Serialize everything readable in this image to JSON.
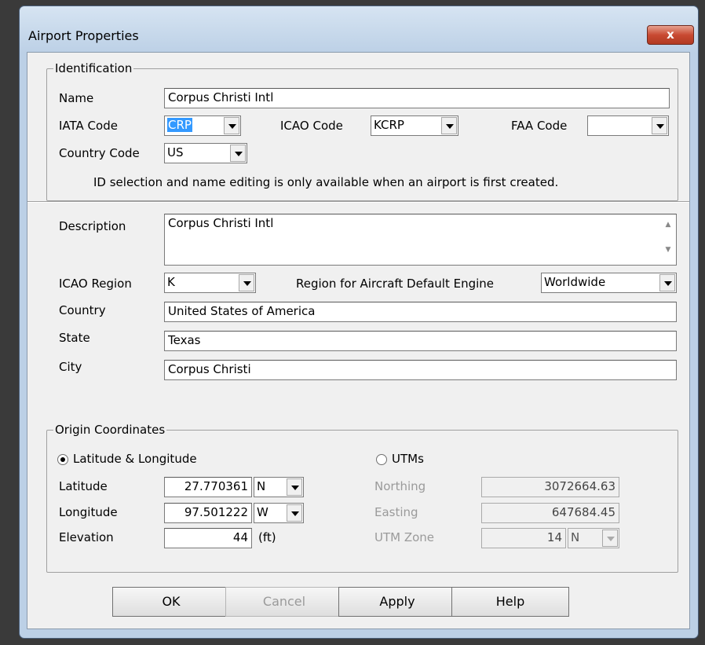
{
  "window": {
    "title": "Airport Properties",
    "close_glyph": "x"
  },
  "identification": {
    "legend": "Identification",
    "name_label": "Name",
    "name_value": "Corpus Christi Intl",
    "iata_label": "IATA Code",
    "iata_value": "CRP",
    "icao_label": "ICAO Code",
    "icao_value": "KCRP",
    "faa_label": "FAA Code",
    "faa_value": "",
    "country_code_label": "Country Code",
    "country_code_value": "US",
    "note": "ID selection and name editing is only available when an airport is first created."
  },
  "details": {
    "description_label": "Description",
    "description_value": "Corpus Christi Intl",
    "icao_region_label": "ICAO Region",
    "icao_region_value": "K",
    "engine_region_label": "Region for Aircraft Default Engine",
    "engine_region_value": "Worldwide",
    "country_label": "Country",
    "country_value": "United States of America",
    "state_label": "State",
    "state_value": "Texas",
    "city_label": "City",
    "city_value": "Corpus Christi"
  },
  "origin": {
    "legend": "Origin Coordinates",
    "latlon_radio_label": "Latitude & Longitude",
    "latlon_selected": true,
    "utm_radio_label": "UTMs",
    "latitude_label": "Latitude",
    "latitude_value": "27.770361",
    "latitude_hemi": "N",
    "longitude_label": "Longitude",
    "longitude_value": "97.501222",
    "longitude_hemi": "W",
    "elevation_label": "Elevation",
    "elevation_value": "44",
    "elevation_unit": "(ft)",
    "northing_label": "Northing",
    "northing_value": "3072664.63",
    "easting_label": "Easting",
    "easting_value": "647684.45",
    "utm_zone_label": "UTM Zone",
    "utm_zone_value": "14",
    "utm_zone_hemi": "N"
  },
  "buttons": {
    "ok": "OK",
    "cancel": "Cancel",
    "apply": "Apply",
    "help": "Help"
  }
}
